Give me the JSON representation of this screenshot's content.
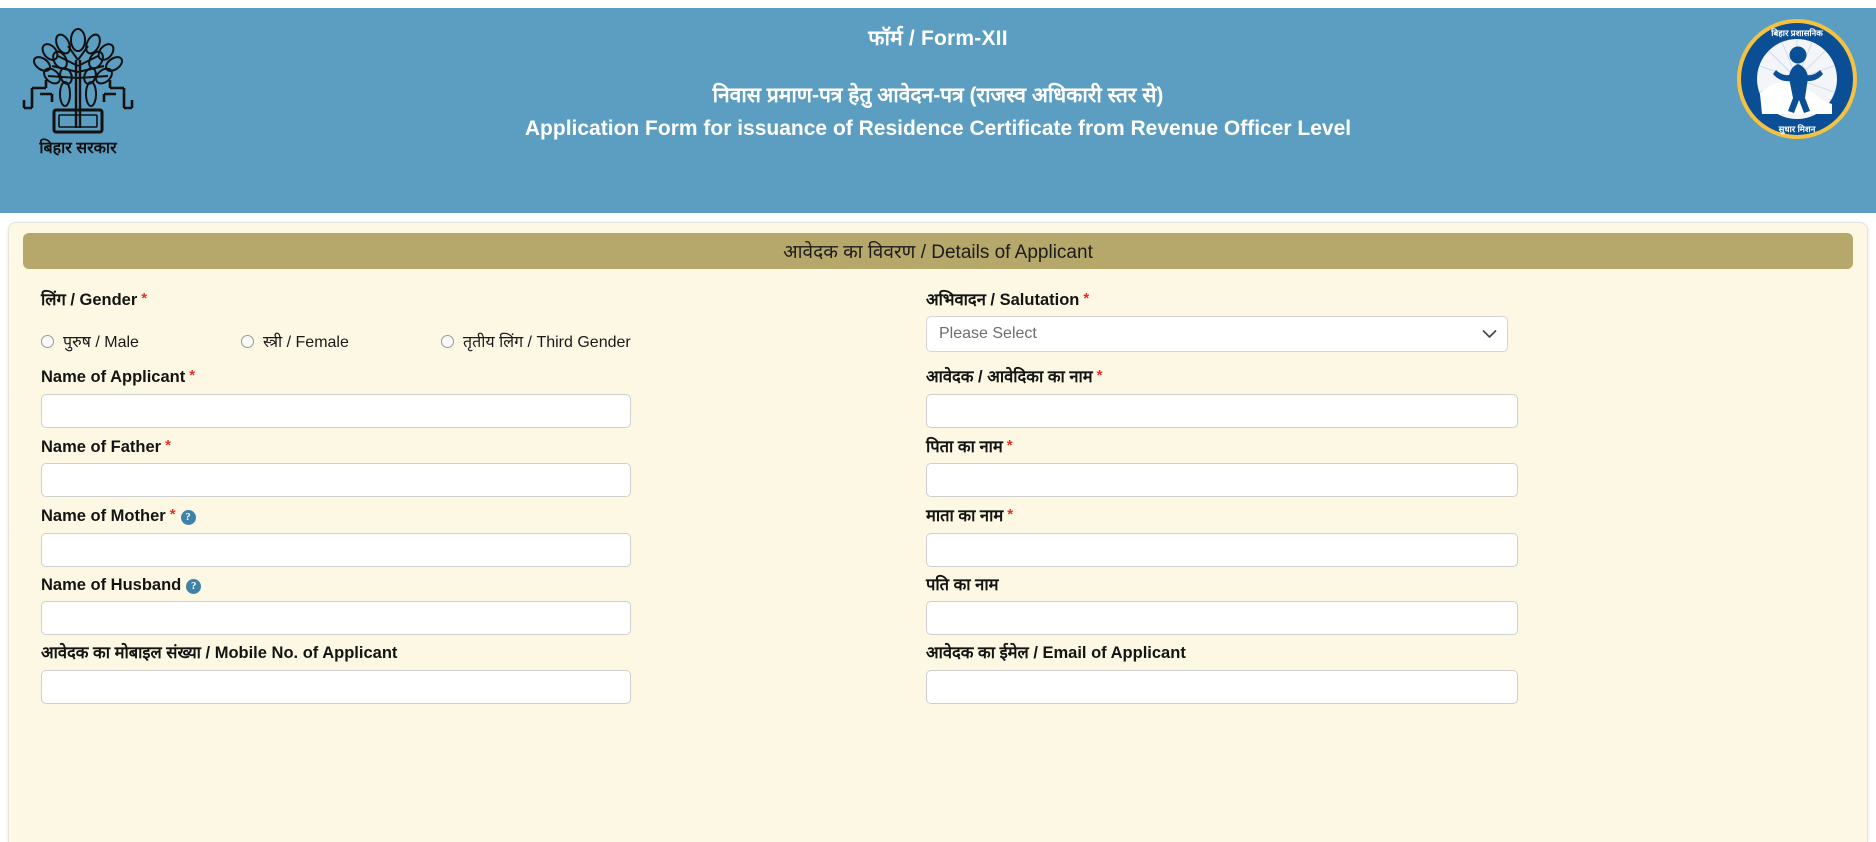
{
  "header": {
    "form_number": "फॉर्म / Form-XII",
    "title_hi": "निवास प्रमाण-पत्र हेतु आवेदन-पत्र (राजस्व अधिकारी स्तर से)",
    "title_en": "Application Form for issuance of  Residence Certificate from Revenue Officer Level",
    "left_logo_caption": "बिहार सरकार",
    "left_logo_name": "bihar-government-emblem",
    "right_logo_name": "bihar-prashasnik-sudhar-mission-logo",
    "right_logo_caption": "बिहार प्रशासनिक सुधार मिशन",
    "band_color": "#5b9ec1"
  },
  "section": {
    "title": "आवेदक का विवरण / Details of Applicant",
    "bar_color": "#b6a76a",
    "card_bg": "#fdf8e3"
  },
  "fields": {
    "gender": {
      "label": "लिंग / Gender",
      "required": "*",
      "options": [
        {
          "label": "पुरुष / Male",
          "value": "male",
          "checked": false
        },
        {
          "label": "स्त्री / Female",
          "value": "female",
          "checked": false
        },
        {
          "label": "तृतीय लिंग / Third Gender",
          "value": "third",
          "checked": false
        }
      ]
    },
    "salutation": {
      "label": "अभिवादन / Salutation",
      "required": "*",
      "selected": "Please Select",
      "options": [
        "Please Select"
      ]
    },
    "applicant_name_en": {
      "label": "Name of Applicant",
      "required": "*",
      "value": "",
      "placeholder": ""
    },
    "applicant_name_hi": {
      "label": "आवेदक / आवेदिका का नाम",
      "required": "*",
      "value": "",
      "placeholder": ""
    },
    "father_name_en": {
      "label": "Name of Father",
      "required": "*",
      "value": "",
      "placeholder": ""
    },
    "father_name_hi": {
      "label": "पिता का नाम",
      "required": "*",
      "value": "",
      "placeholder": ""
    },
    "mother_name_en": {
      "label": "Name of Mother",
      "required": "*",
      "help": "?",
      "value": "",
      "placeholder": ""
    },
    "mother_name_hi": {
      "label": "माता का नाम",
      "required": "*",
      "value": "",
      "placeholder": ""
    },
    "husband_name_en": {
      "label": "Name of Husband",
      "required": "",
      "help": "?",
      "value": "",
      "placeholder": ""
    },
    "husband_name_hi": {
      "label": "पति का नाम",
      "required": "",
      "value": "",
      "placeholder": ""
    },
    "mobile": {
      "label": "आवेदक का मोबाइल संख्या / Mobile No. of Applicant",
      "required": "",
      "value": "",
      "placeholder": ""
    },
    "email": {
      "label": "आवेदक का ईमेल / Email of Applicant",
      "required": "",
      "value": "",
      "placeholder": ""
    }
  },
  "icons": {
    "chevron_down": "chevron-down-icon",
    "help": "help-circle-icon"
  },
  "colors": {
    "header_blue": "#5b9ec1",
    "section_tan": "#b6a76a",
    "card_cream": "#fdf8e3",
    "required_red": "#e2322a",
    "help_blue": "#3f82a8"
  }
}
